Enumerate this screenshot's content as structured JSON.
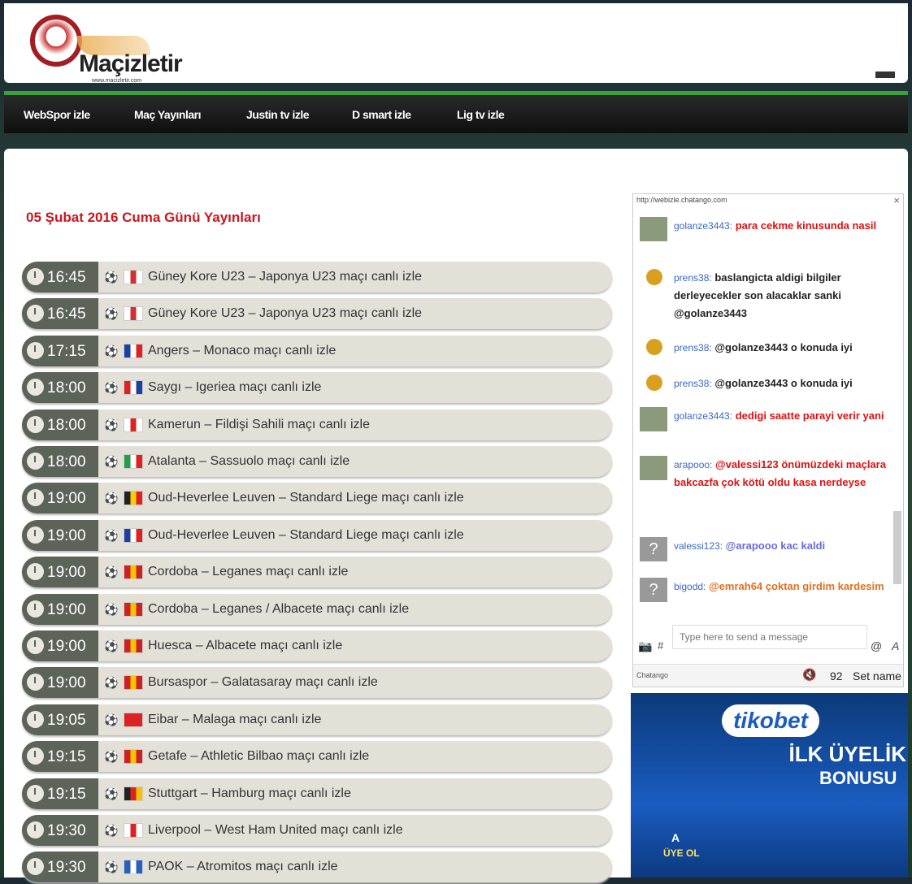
{
  "site": {
    "name": "Maçizletir",
    "url": "www.macizletir.com"
  },
  "nav": [
    {
      "label": "WebSpor izle"
    },
    {
      "label": "Maç Yayınları"
    },
    {
      "label": "Justin tv izle"
    },
    {
      "label": "D smart izle"
    },
    {
      "label": "Lig tv izle"
    }
  ],
  "day_title": "05 Şubat 2016 Cuma Günü Yayınları",
  "matches": [
    {
      "time": "16:45",
      "title": "Güney Kore U23 – Japonya U23 maçı canlı izle",
      "flag": [
        "#fff",
        "#c33",
        "#fff"
      ]
    },
    {
      "time": "16:45",
      "title": "Güney Kore U23 – Japonya U23 maçı canlı izle",
      "flag": [
        "#fff",
        "#c33",
        "#fff"
      ]
    },
    {
      "time": "17:15",
      "title": "Angers – Monaco maçı canlı izle",
      "flag": [
        "#1f3fa0",
        "#fff",
        "#d22"
      ]
    },
    {
      "time": "18:00",
      "title": "Saygı – Igeriea maçı canlı izle",
      "flag": [
        "#d22",
        "#fff",
        "#1f3fa0"
      ]
    },
    {
      "time": "18:00",
      "title": "Kamerun – Fildişi Sahili maçı canlı izle",
      "flag": [
        "#fff",
        "#d22",
        "#fff"
      ]
    },
    {
      "time": "18:00",
      "title": "Atalanta – Sassuolo maçı canlı izle",
      "flag": [
        "#2a9a4a",
        "#fff",
        "#d22"
      ]
    },
    {
      "time": "19:00",
      "title": "Oud-Heverlee Leuven – Standard Liege maçı canlı izle",
      "flag": [
        "#222",
        "#f5d000",
        "#d22"
      ]
    },
    {
      "time": "19:00",
      "title": "Oud-Heverlee Leuven – Standard Liege maçı canlı izle",
      "flag": [
        "#1f3fa0",
        "#fff",
        "#d22"
      ]
    },
    {
      "time": "19:00",
      "title": "Cordoba – Leganes maçı canlı izle",
      "flag": [
        "#c22",
        "#f5c400",
        "#c22"
      ]
    },
    {
      "time": "19:00",
      "title": "Cordoba – Leganes / Albacete maçı canlı izle",
      "flag": [
        "#c22",
        "#f5c400",
        "#c22"
      ]
    },
    {
      "time": "19:00",
      "title": "Huesca – Albacete maçı canlı izle",
      "flag": [
        "#c22",
        "#f5c400",
        "#c22"
      ]
    },
    {
      "time": "19:00",
      "title": "Bursaspor – Galatasaray maçı canlı izle",
      "flag": [
        "#c22",
        "#f5c400",
        "#c22"
      ]
    },
    {
      "time": "19:05",
      "title": "Eibar – Malaga maçı canlı izle",
      "flag": [
        "#d22",
        "#d22",
        "#d22"
      ]
    },
    {
      "time": "19:15",
      "title": "Getafe – Athletic Bilbao maçı canlı izle",
      "flag": [
        "#c22",
        "#f5c400",
        "#c22"
      ]
    },
    {
      "time": "19:15",
      "title": "Stuttgart – Hamburg maçı canlı izle",
      "flag": [
        "#222",
        "#d22",
        "#f5c400"
      ]
    },
    {
      "time": "19:30",
      "title": "Liverpool – West Ham United maçı canlı izle",
      "flag": [
        "#fff",
        "#d22",
        "#fff"
      ]
    },
    {
      "time": "19:30",
      "title": "PAOK – Atromitos maçı canlı izle",
      "flag": [
        "#2a5fc0",
        "#fff",
        "#2a5fc0"
      ]
    }
  ],
  "chat": {
    "url": "http://webizle.chatango.com",
    "close": "×",
    "messages": [
      {
        "user": "golanze3443:",
        "text": "para cekme kinusunda nasil",
        "color": "#d11",
        "avatar": "photo"
      },
      {
        "user": "prens38:",
        "text": "baslangicta aldigi bilgiler derleyecekler son alacaklar sanki @golanze3443",
        "color": "#222",
        "avatar": "badge"
      },
      {
        "user": "prens38:",
        "text": "@golanze3443 o konuda iyi",
        "color": "#222",
        "avatar": "badge"
      },
      {
        "user": "prens38:",
        "text": "@golanze3443 o konuda iyi",
        "color": "#222",
        "avatar": "badge"
      },
      {
        "user": "golanze3443:",
        "text": "dedigi saatte parayi verir yani",
        "color": "#d11",
        "avatar": "photo"
      },
      {
        "user": "arapooo:",
        "text": "@valessi123 önümüzdeki maçlara bakcazfa çok kötü oldu kasa nerdeyse",
        "color": "#d11",
        "avatar": "photo"
      },
      {
        "user": "valessi123:",
        "text": "@arapooo kac kaldi",
        "color": "#6a6adf",
        "avatar": "?"
      },
      {
        "user": "bigodd:",
        "text": "@emrah64 çoktan girdim kardesim",
        "color": "#e07020",
        "avatar": "?"
      }
    ],
    "input_placeholder": "Type here to send a message",
    "brand": "Chatango",
    "mute_icon": "🔇",
    "user_count": "92",
    "set_name": "Set name",
    "hash": "#",
    "at": "@",
    "font": "A"
  },
  "ad": {
    "brand": "tikobet",
    "line1": "İLK ÜYELİK",
    "line2": "BONUSU",
    "line3": "A",
    "line4": "ÜYE OL"
  }
}
